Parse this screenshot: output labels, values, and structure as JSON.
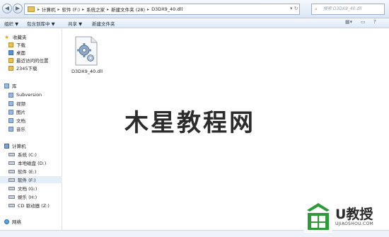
{
  "address_bar": {
    "crumbs": [
      "计算机",
      "软件 (F:)",
      "系统之家",
      "新建文件夹 (28)",
      "D3DX9_40.dll"
    ],
    "search_placeholder": "搜索 D3DX9_40.dll"
  },
  "toolbar": {
    "organize": "组织 ▼",
    "open_with": "包含到库中 ▼",
    "share": "共享 ▼",
    "new_folder": "新建文件夹"
  },
  "sidebar": {
    "favorites": {
      "header": "收藏夹",
      "items": [
        "下载",
        "桌面",
        "最近访问的位置",
        "2345下载"
      ]
    },
    "libraries": {
      "header": "库",
      "items": [
        "Subversion",
        "视频",
        "图片",
        "文档",
        "音乐"
      ]
    },
    "computer": {
      "header": "计算机",
      "items": [
        "系统 (C:)",
        "本地磁盘 (D:)",
        "软件 (E:)",
        "软件 (F:)",
        "文档 (G:)",
        "娱乐 (H:)",
        "CD 驱动器 (Z:)"
      ]
    },
    "network": {
      "header": "网络"
    }
  },
  "content": {
    "files": [
      {
        "name": "D3DX9_40.dll",
        "icon": "dll-gear-icon"
      }
    ]
  },
  "watermark": {
    "text": "木星教程网"
  },
  "logo": {
    "main": "U教授",
    "sub": "UJIAOSHOU.COM"
  },
  "colors": {
    "logo_green": "#2e9a3a",
    "folder": "#e8c15a",
    "selection": "#e4eef9"
  }
}
